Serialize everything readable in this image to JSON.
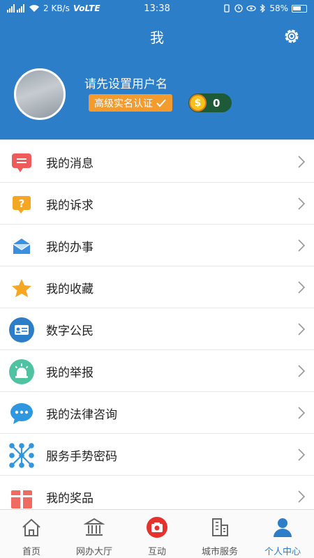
{
  "status_bar": {
    "net_speed": "2 KB/s",
    "volte": "VoLTE",
    "time": "13:38",
    "battery": "58%"
  },
  "header": {
    "title": "我",
    "username": "请先设置用户名",
    "verify_badge": "高级实名认证",
    "coin_symbol": "$",
    "coin_count": "0"
  },
  "menu": [
    {
      "label": "我的消息",
      "icon": "message-icon",
      "color": "#ef5b5b"
    },
    {
      "label": "我的诉求",
      "icon": "question-icon",
      "color": "#f5a623"
    },
    {
      "label": "我的办事",
      "icon": "envelope-icon",
      "color": "#3a8fe0"
    },
    {
      "label": "我的收藏",
      "icon": "star-icon",
      "color": "#f5a623"
    },
    {
      "label": "数字公民",
      "icon": "id-card-icon",
      "color": "#2d7ec9"
    },
    {
      "label": "我的举报",
      "icon": "alarm-icon",
      "color": "#4fc3a1"
    },
    {
      "label": "我的法律咨询",
      "icon": "chat-icon",
      "color": "#2e97e0"
    },
    {
      "label": "服务手势密码",
      "icon": "gesture-icon",
      "color": "#2e97e0"
    },
    {
      "label": "我的奖品",
      "icon": "gift-icon",
      "color": "#ef5b5b"
    }
  ],
  "tabbar": [
    {
      "label": "首页",
      "icon": "home-icon"
    },
    {
      "label": "网办大厅",
      "icon": "hall-icon"
    },
    {
      "label": "互动",
      "icon": "camera-icon"
    },
    {
      "label": "城市服务",
      "icon": "building-icon"
    },
    {
      "label": "个人中心",
      "icon": "person-icon"
    }
  ],
  "colors": {
    "header_bg": "#2d7ec9",
    "badge_bg": "#f39b2d",
    "coin_pill_bg": "#1d5a38",
    "active_tab": "#2d7ec9"
  }
}
